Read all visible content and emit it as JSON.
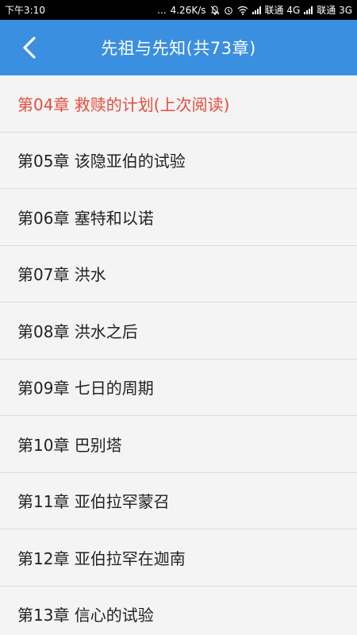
{
  "status_bar": {
    "time": "下午3:10",
    "dots": "...",
    "speed": "4.26K/s",
    "carrier1": "联通 4G",
    "carrier2": "联通 3G"
  },
  "header": {
    "title": "先祖与先知(共73章)",
    "back_icon": "chevron-left-icon"
  },
  "colors": {
    "appbar": "#3a8fe0",
    "current": "#e74c3c"
  },
  "chapters": [
    {
      "label": "第04章 救赎的计划(上次阅读)",
      "current": true
    },
    {
      "label": "第05章 该隐亚伯的试验"
    },
    {
      "label": "第06章 塞特和以诺"
    },
    {
      "label": "第07章 洪水"
    },
    {
      "label": "第08章 洪水之后"
    },
    {
      "label": "第09章 七日的周期"
    },
    {
      "label": "第10章 巴别塔"
    },
    {
      "label": "第11章 亚伯拉罕蒙召"
    },
    {
      "label": "第12章 亚伯拉罕在迦南"
    },
    {
      "label": "第13章 信心的试验"
    }
  ]
}
